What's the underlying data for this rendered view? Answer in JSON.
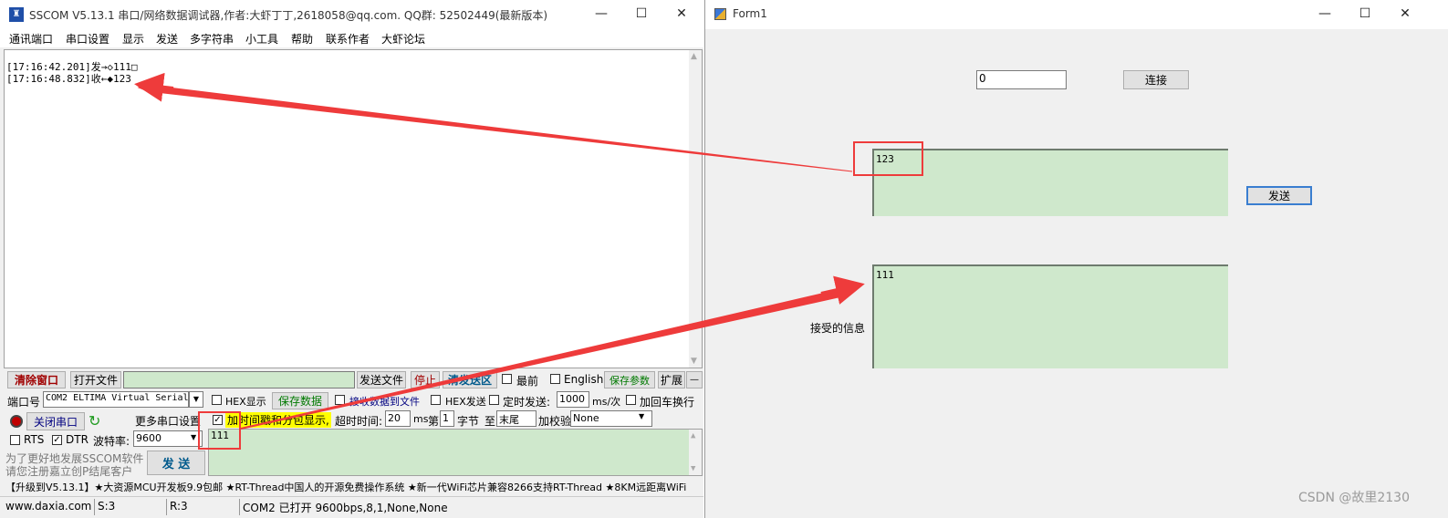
{
  "sscom": {
    "title": "SSCOM V5.13.1 串口/网络数据调试器,作者:大虾丁丁,2618058@qq.com. QQ群: 52502449(最新版本)",
    "menu": [
      "通讯端口",
      "串口设置",
      "显示",
      "发送",
      "多字符串",
      "小工具",
      "帮助",
      "联系作者",
      "大虾论坛"
    ],
    "log_lines": [
      "[17:16:42.201]发→◇111□",
      "[17:16:48.832]收←◆123"
    ],
    "toolbar1": {
      "clear_window": "清除窗口",
      "open_file": "打开文件",
      "send_file": "发送文件",
      "stop": "停止",
      "clear_send_area": "清发送区",
      "topmost": "最前",
      "english": "English",
      "save_params": "保存参数",
      "expand": "扩展",
      "minus": "—"
    },
    "row2": {
      "port_label": "端口号",
      "port_value": "COM2 ELTIMA Virtual Serial",
      "hex_display": "HEX显示",
      "save_data": "保存数据",
      "recv_to_file": "接收数据到文件",
      "hex_send": "HEX发送",
      "timed_send": "定时发送:",
      "interval": "1000",
      "interval_unit": "ms/次",
      "crlf": "加回车换行"
    },
    "row3": {
      "close_port": "关闭串口",
      "more_settings": "更多串口设置",
      "timestamp": "加时间戳和分包显示,",
      "timeout_label": "超时时间:",
      "timeout_value": "20",
      "timeout_unit": "ms",
      "byte_prefix": "第",
      "byte_index": "1",
      "byte_label": "字节",
      "to_label": "至",
      "end_value": "末尾",
      "checksum_label": "加校验",
      "checksum_value": "None"
    },
    "row4": {
      "rts": "RTS",
      "dtr": "DTR",
      "baud_label": "波特率:",
      "baud_value": "9600"
    },
    "promo_text": [
      "为了更好地发展SSCOM软件",
      "请您注册嘉立创P结尾客户"
    ],
    "send_button": "发 送",
    "send_text": "111",
    "ticker": "【升级到V5.13.1】★大资源MCU开发板9.9包邮 ★RT-Thread中国人的开源免费操作系统 ★新一代WiFi芯片兼容8266支持RT-Thread ★8KM远距离WiFi",
    "status": {
      "url": "www.daxia.com",
      "sent": "S:3",
      "received": "R:3",
      "port_state": "COM2 已打开  9600bps,8,1,None,None"
    }
  },
  "form1": {
    "title": "Form1",
    "port_input": "0",
    "connect_button": "连接",
    "received_box": "123",
    "send_box": "111",
    "send_button": "发送",
    "received_label": "接受的信息"
  },
  "watermark": "CSDN @故里2130",
  "colors": {
    "green_box": "#cfe8cc",
    "annotation_red": "#ee3b3b"
  }
}
